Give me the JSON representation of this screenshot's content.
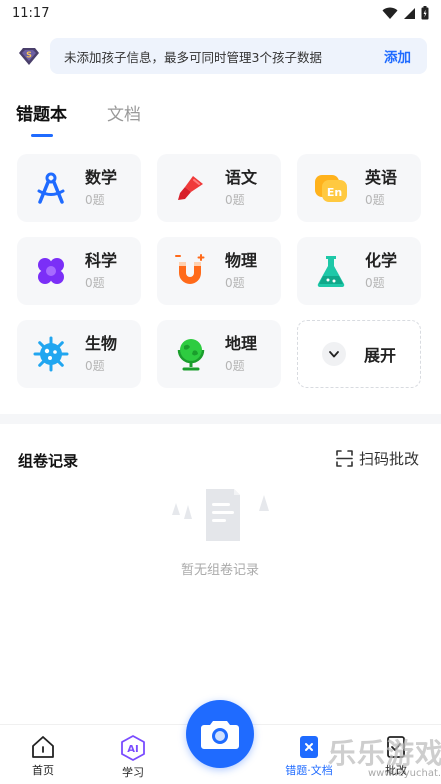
{
  "status_bar": {
    "time": "11:17"
  },
  "banner": {
    "text": "未添加孩子信息，最多可同时管理3个孩子数据",
    "action": "添加"
  },
  "tabs": [
    {
      "label": "错题本",
      "active": true
    },
    {
      "label": "文档",
      "active": false
    }
  ],
  "subjects": [
    {
      "name": "数学",
      "count": "0题",
      "icon": "compass-icon"
    },
    {
      "name": "语文",
      "count": "0题",
      "icon": "brush-icon"
    },
    {
      "name": "英语",
      "count": "0题",
      "icon": "en-bubble-icon"
    },
    {
      "name": "科学",
      "count": "0题",
      "icon": "flower-icon"
    },
    {
      "name": "物理",
      "count": "0题",
      "icon": "magnet-icon"
    },
    {
      "name": "化学",
      "count": "0题",
      "icon": "flask-icon"
    },
    {
      "name": "生物",
      "count": "0题",
      "icon": "virus-icon"
    },
    {
      "name": "地理",
      "count": "0题",
      "icon": "globe-icon"
    }
  ],
  "expand_label": "展开",
  "records": {
    "title": "组卷记录",
    "scan_label": "扫码批改",
    "empty_text": "暂无组卷记录"
  },
  "bottom_nav": [
    {
      "label": "首页",
      "icon": "home-icon"
    },
    {
      "label": "学习",
      "icon": "ai-icon"
    },
    {
      "label": "错题·文档",
      "icon": "wrong-book-icon",
      "active": true
    },
    {
      "label": "批改",
      "icon": "grading-icon"
    }
  ],
  "watermark": {
    "big": "乐乐游戏",
    "small": "www.leyuchat.com"
  },
  "colors": {
    "accent": "#1f6bff",
    "math": "#1f6bff",
    "chinese": "#f03a3a",
    "english": "#ffb21c",
    "science": "#7b2ff7",
    "physics": "#ff6a1a",
    "chemistry": "#1ec8a8",
    "biology": "#21a6f0",
    "geography": "#2ecc40"
  }
}
